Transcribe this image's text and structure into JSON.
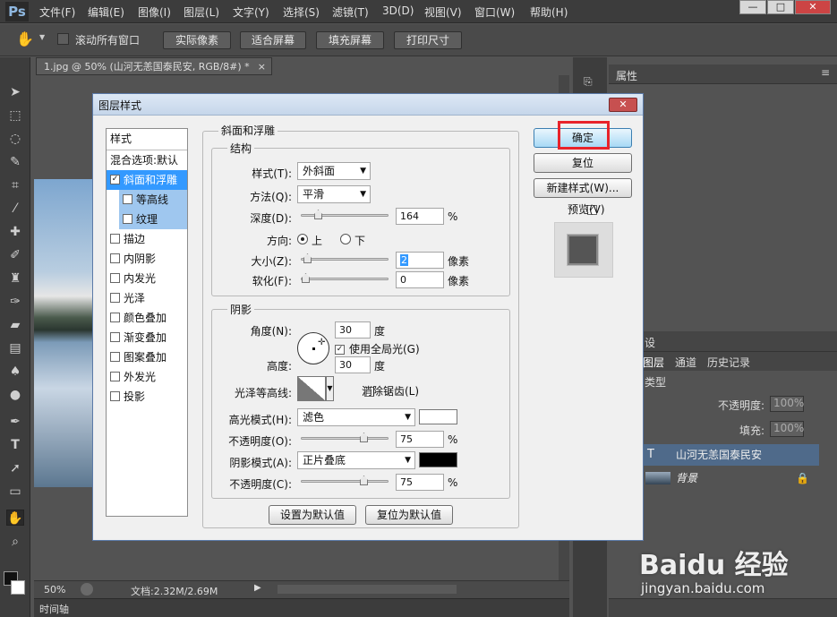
{
  "app": {
    "logo": "Ps"
  },
  "menu": [
    "文件(F)",
    "编辑(E)",
    "图像(I)",
    "图层(L)",
    "文字(Y)",
    "选择(S)",
    "滤镜(T)",
    "3D(D)",
    "视图(V)",
    "窗口(W)",
    "帮助(H)"
  ],
  "window_controls": {
    "minimize": "—",
    "maximize": "□",
    "close": "✕"
  },
  "options": {
    "scroll_all_label": "滚动所有窗口",
    "actual_pixels": "实际像素",
    "fit_screen": "适合屏幕",
    "fill_screen": "填充屏幕",
    "print_size": "打印尺寸"
  },
  "document_tab": {
    "title": "1.jpg @ 50% (山河无恙国泰民安, RGB/8#) *",
    "close": "×"
  },
  "status": {
    "zoom": "50%",
    "doc_size": "文档:2.32M/2.69M"
  },
  "timeline_label": "时间轴",
  "properties_panel": {
    "tab": "属性"
  },
  "layers_panel": {
    "tab_partial": "设",
    "tabs": [
      "图层",
      "通道",
      "历史记录"
    ],
    "kind_label": "类型",
    "opacity_label": "不透明度:",
    "opacity_value": "100%",
    "fill_label": "填充:",
    "fill_value": "100%",
    "layers": [
      {
        "name": "山河无恙国泰民安",
        "type_icon": "T"
      },
      {
        "name": "背景"
      }
    ]
  },
  "watermark": {
    "brand": "Baidu 经验",
    "url": "jingyan.baidu.com"
  },
  "dialog": {
    "title": "图层样式",
    "close": "✕",
    "style_list": {
      "header": "样式",
      "items": [
        {
          "label": "混合选项:默认",
          "checked": null,
          "selected": false,
          "indent": false
        },
        {
          "label": "斜面和浮雕",
          "checked": true,
          "selected": true,
          "indent": false
        },
        {
          "label": "等高线",
          "checked": false,
          "selected": true,
          "indent": true
        },
        {
          "label": "纹理",
          "checked": false,
          "selected": true,
          "indent": true
        },
        {
          "label": "描边",
          "checked": false,
          "selected": false,
          "indent": false
        },
        {
          "label": "内阴影",
          "checked": false,
          "selected": false,
          "indent": false
        },
        {
          "label": "内发光",
          "checked": false,
          "selected": false,
          "indent": false
        },
        {
          "label": "光泽",
          "checked": false,
          "selected": false,
          "indent": false
        },
        {
          "label": "颜色叠加",
          "checked": false,
          "selected": false,
          "indent": false
        },
        {
          "label": "渐变叠加",
          "checked": false,
          "selected": false,
          "indent": false
        },
        {
          "label": "图案叠加",
          "checked": false,
          "selected": false,
          "indent": false
        },
        {
          "label": "外发光",
          "checked": false,
          "selected": false,
          "indent": false
        },
        {
          "label": "投影",
          "checked": false,
          "selected": false,
          "indent": false
        }
      ]
    },
    "bevel": {
      "group_title": "斜面和浮雕",
      "structure_title": "结构",
      "style_label": "样式(T):",
      "style_value": "外斜面",
      "technique_label": "方法(Q):",
      "technique_value": "平滑",
      "depth_label": "深度(D):",
      "depth_value": "164",
      "depth_unit": "%",
      "depth_level": 0.164,
      "direction_label": "方向:",
      "direction_up": "上",
      "direction_down": "下",
      "size_label": "大小(Z):",
      "size_value": "2",
      "size_unit": "像素",
      "size_level": 0.02,
      "soften_label": "软化(F):",
      "soften_value": "0",
      "soften_unit": "像素",
      "soften_level": 0.0
    },
    "shading": {
      "title": "阴影",
      "angle_label": "角度(N):",
      "angle_value": "30",
      "angle_unit": "度",
      "global_light_label": "使用全局光(G)",
      "altitude_label": "高度:",
      "altitude_value": "30",
      "altitude_unit": "度",
      "gloss_label": "光泽等高线:",
      "antialias_label": "消除锯齿(L)",
      "highlight_mode_label": "高光模式(H):",
      "highlight_mode_value": "滤色",
      "highlight_color": "#ffffff",
      "highlight_opacity_label": "不透明度(O):",
      "highlight_opacity_value": "75",
      "highlight_opacity_unit": "%",
      "highlight_opacity_level": 0.75,
      "shadow_mode_label": "阴影模式(A):",
      "shadow_mode_value": "正片叠底",
      "shadow_color": "#000000",
      "shadow_opacity_label": "不透明度(C):",
      "shadow_opacity_value": "75",
      "shadow_opacity_unit": "%",
      "shadow_opacity_level": 0.75
    },
    "buttons": {
      "set_default": "设置为默认值",
      "reset_default": "复位为默认值",
      "ok": "确定",
      "reset": "复位",
      "new_style": "新建样式(W)...",
      "preview": "预览(V)"
    },
    "highlight_box_color": "#e8232a"
  }
}
